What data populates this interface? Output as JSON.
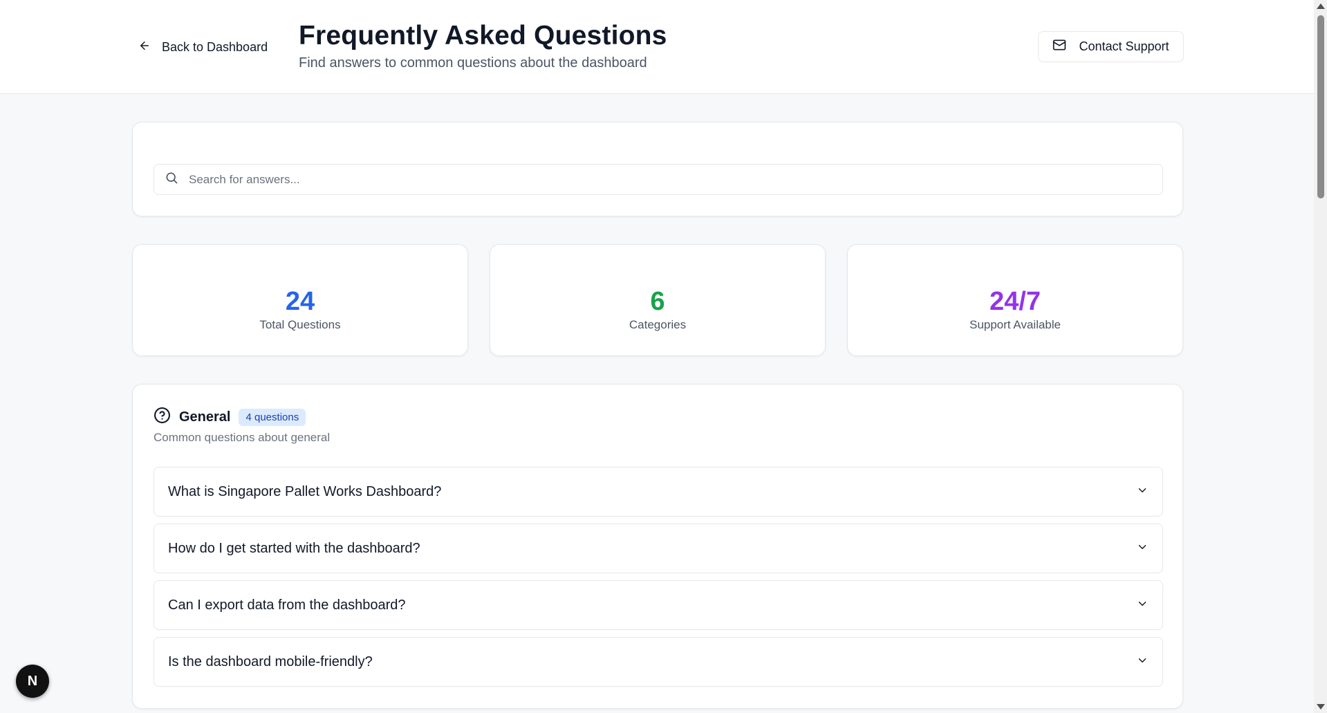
{
  "header": {
    "back_label": "Back to Dashboard",
    "title": "Frequently Asked Questions",
    "subtitle": "Find answers to common questions about the dashboard",
    "contact_label": "Contact Support"
  },
  "search": {
    "placeholder": "Search for answers...",
    "value": ""
  },
  "stats": [
    {
      "value": "24",
      "label": "Total Questions",
      "color": "#2563eb"
    },
    {
      "value": "6",
      "label": "Categories",
      "color": "#16a34a"
    },
    {
      "value": "24/7",
      "label": "Support Available",
      "color": "#9333ea"
    }
  ],
  "category": {
    "icon": "help-circle-icon",
    "title": "General",
    "badge": "4 questions",
    "description": "Common questions about general",
    "questions": [
      "What is Singapore Pallet Works Dashboard?",
      "How do I get started with the dashboard?",
      "Can I export data from the dashboard?",
      "Is the dashboard mobile-friendly?"
    ]
  },
  "dev_badge": {
    "label": "N"
  },
  "colors": {
    "accent_blue": "#2563eb",
    "accent_green": "#16a34a",
    "accent_purple": "#9333ea",
    "badge_bg": "#dbeafe"
  }
}
